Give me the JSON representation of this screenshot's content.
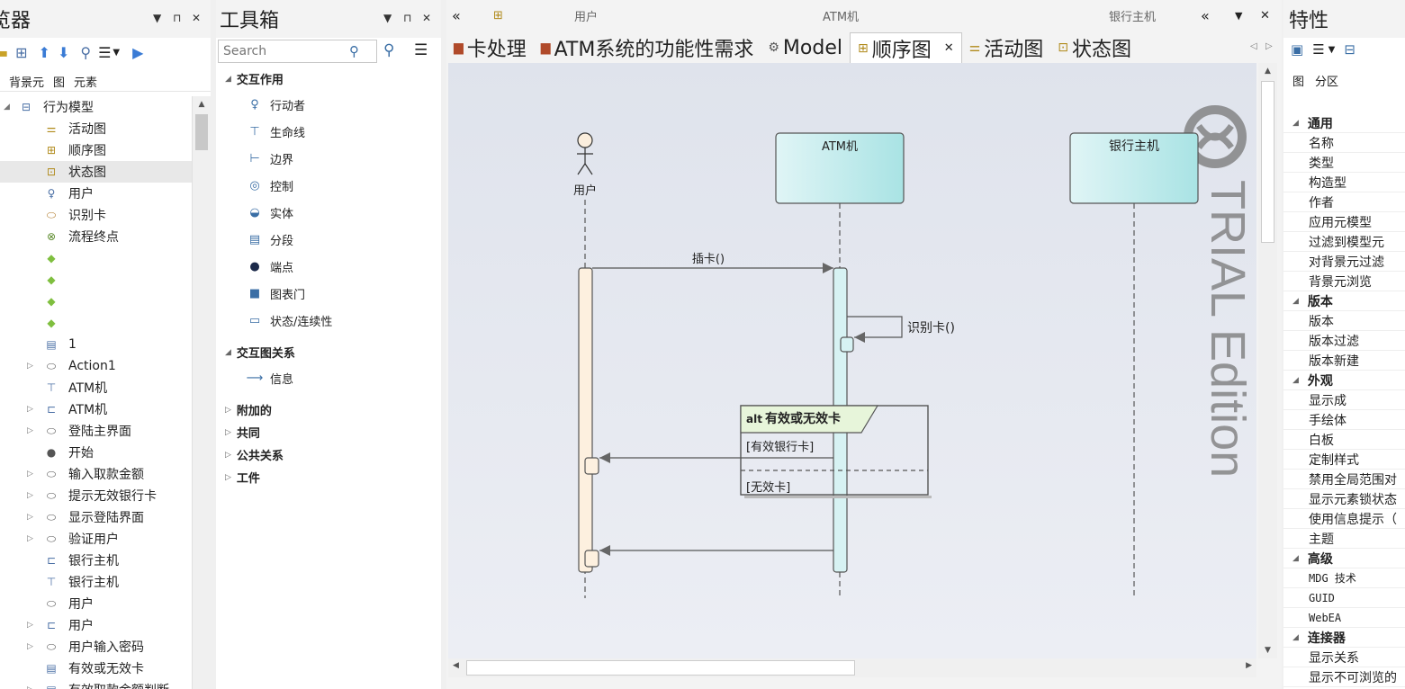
{
  "browser": {
    "title": "览器",
    "subtabs": [
      "背景元",
      "图",
      "元素"
    ],
    "tree": [
      {
        "label": "行为模型",
        "icon": "package-icon",
        "indent": 0,
        "exp": "◢",
        "sel": false
      },
      {
        "label": "活动图",
        "icon": "activity-diagram-icon",
        "indent": 1,
        "sel": false
      },
      {
        "label": "顺序图",
        "icon": "sequence-diagram-icon",
        "indent": 1,
        "sel": false
      },
      {
        "label": "状态图",
        "icon": "state-diagram-icon",
        "indent": 1,
        "sel": true
      },
      {
        "label": "用户",
        "icon": "actor-icon",
        "indent": 1,
        "sel": false
      },
      {
        "label": "识别卡",
        "icon": "usecase-icon",
        "indent": 1,
        "sel": false
      },
      {
        "label": "流程终点",
        "icon": "flow-final-icon",
        "indent": 1,
        "sel": false
      },
      {
        "label": "",
        "icon": "decision-icon",
        "indent": 1,
        "sel": false
      },
      {
        "label": "",
        "icon": "decision-icon",
        "indent": 1,
        "sel": false
      },
      {
        "label": "",
        "icon": "decision-icon",
        "indent": 1,
        "sel": false
      },
      {
        "label": "",
        "icon": "decision-icon",
        "indent": 1,
        "sel": false
      },
      {
        "label": "1",
        "icon": "table-icon",
        "indent": 1,
        "sel": false
      },
      {
        "label": "Action1",
        "icon": "action-icon",
        "indent": 1,
        "exp": "▷",
        "sel": false
      },
      {
        "label": "ATM机",
        "icon": "lifeline-icon",
        "indent": 1,
        "sel": false
      },
      {
        "label": "ATM机",
        "icon": "class-icon",
        "indent": 1,
        "exp": "▷",
        "sel": false
      },
      {
        "label": "登陆主界面",
        "icon": "action-icon",
        "indent": 1,
        "exp": "▷",
        "sel": false
      },
      {
        "label": "开始",
        "icon": "initial-icon",
        "indent": 1,
        "sel": false
      },
      {
        "label": "输入取款金额",
        "icon": "action-icon",
        "indent": 1,
        "exp": "▷",
        "sel": false
      },
      {
        "label": "提示无效银行卡",
        "icon": "action-icon",
        "indent": 1,
        "exp": "▷",
        "sel": false
      },
      {
        "label": "显示登陆界面",
        "icon": "action-icon",
        "indent": 1,
        "exp": "▷",
        "sel": false
      },
      {
        "label": "验证用户",
        "icon": "action-icon",
        "indent": 1,
        "exp": "▷",
        "sel": false
      },
      {
        "label": "银行主机",
        "icon": "class-icon",
        "indent": 1,
        "sel": false
      },
      {
        "label": "银行主机",
        "icon": "lifeline-icon",
        "indent": 1,
        "sel": false
      },
      {
        "label": "用户",
        "icon": "action-icon",
        "indent": 1,
        "sel": false
      },
      {
        "label": "用户",
        "icon": "class-icon",
        "indent": 1,
        "exp": "▷",
        "sel": false
      },
      {
        "label": "用户输入密码",
        "icon": "action-icon",
        "indent": 1,
        "exp": "▷",
        "sel": false
      },
      {
        "label": "有效或无效卡",
        "icon": "fragment-icon",
        "indent": 1,
        "sel": false
      },
      {
        "label": "有效取款金额判断",
        "icon": "fragment-icon",
        "indent": 1,
        "exp": "▷",
        "sel": false
      }
    ]
  },
  "toolbox": {
    "title": "工具箱",
    "search_placeholder": "Search",
    "sections": [
      {
        "label": "交互作用",
        "open": true,
        "items": [
          {
            "label": "行动者",
            "icon": "actor-icon"
          },
          {
            "label": "生命线",
            "icon": "lifeline-icon"
          },
          {
            "label": "边界",
            "icon": "boundary-icon"
          },
          {
            "label": "控制",
            "icon": "control-icon"
          },
          {
            "label": "实体",
            "icon": "entity-icon"
          },
          {
            "label": "分段",
            "icon": "fragment-icon"
          },
          {
            "label": "端点",
            "icon": "endpoint-icon"
          },
          {
            "label": "图表门",
            "icon": "gate-icon"
          },
          {
            "label": "状态/连续性",
            "icon": "state-icon"
          }
        ]
      },
      {
        "label": "交互图关系",
        "open": true,
        "items": [
          {
            "label": "信息",
            "icon": "message-icon"
          }
        ]
      },
      {
        "label": "附加的",
        "open": false,
        "items": []
      },
      {
        "label": "共同",
        "open": false,
        "items": []
      },
      {
        "label": "公共关系",
        "open": false,
        "items": []
      },
      {
        "label": "工件",
        "open": false,
        "items": []
      }
    ]
  },
  "diagram": {
    "header_labels": [
      "用户",
      "ATM机",
      "银行主机"
    ],
    "tabs": [
      {
        "label": "卡处理",
        "icon": "tree-icon",
        "active": false
      },
      {
        "label": "ATM系统的功能性需求",
        "icon": "tree-icon",
        "active": false
      },
      {
        "label": "Model",
        "icon": "model-icon",
        "active": false
      },
      {
        "label": "顺序图",
        "icon": "sequence-diagram-icon",
        "active": true
      },
      {
        "label": "活动图",
        "icon": "activity-diagram-icon",
        "active": false
      },
      {
        "label": "状态图",
        "icon": "state-diagram-icon",
        "active": false
      }
    ],
    "actor_label": "用户",
    "atm_label": "ATM机",
    "bank_label": "银行主机",
    "msg_insert": "插卡()",
    "msg_identify": "识别卡()",
    "fragment_keyword": "alt",
    "fragment_title": "有效或无效卡",
    "guard1": "[有效银行卡]",
    "guard2": "[无效卡]",
    "watermark": "TRIAL Edition"
  },
  "props": {
    "title": "特性",
    "subtabs": [
      "图",
      "分区"
    ],
    "rows": [
      {
        "label": "通用",
        "group": true
      },
      {
        "label": "名称"
      },
      {
        "label": "类型"
      },
      {
        "label": "构造型"
      },
      {
        "label": "作者"
      },
      {
        "label": "应用元模型"
      },
      {
        "label": "过滤到模型元"
      },
      {
        "label": "对背景元过滤"
      },
      {
        "label": "背景元浏览"
      },
      {
        "label": "版本",
        "group": true
      },
      {
        "label": "版本"
      },
      {
        "label": "版本过滤"
      },
      {
        "label": "版本新建"
      },
      {
        "label": "外观",
        "group": true
      },
      {
        "label": "显示成"
      },
      {
        "label": "手绘体"
      },
      {
        "label": "白板"
      },
      {
        "label": "定制样式"
      },
      {
        "label": "禁用全局范围对"
      },
      {
        "label": "显示元素锁状态"
      },
      {
        "label": "使用信息提示（"
      },
      {
        "label": "主题"
      },
      {
        "label": "高级",
        "group": true
      },
      {
        "label": "MDG 技术",
        "mono": true
      },
      {
        "label": "GUID",
        "mono": true
      },
      {
        "label": "WebEA",
        "mono": true
      },
      {
        "label": "连接器",
        "group": true
      },
      {
        "label": "显示关系"
      },
      {
        "label": "显示不可浏览的"
      }
    ]
  }
}
